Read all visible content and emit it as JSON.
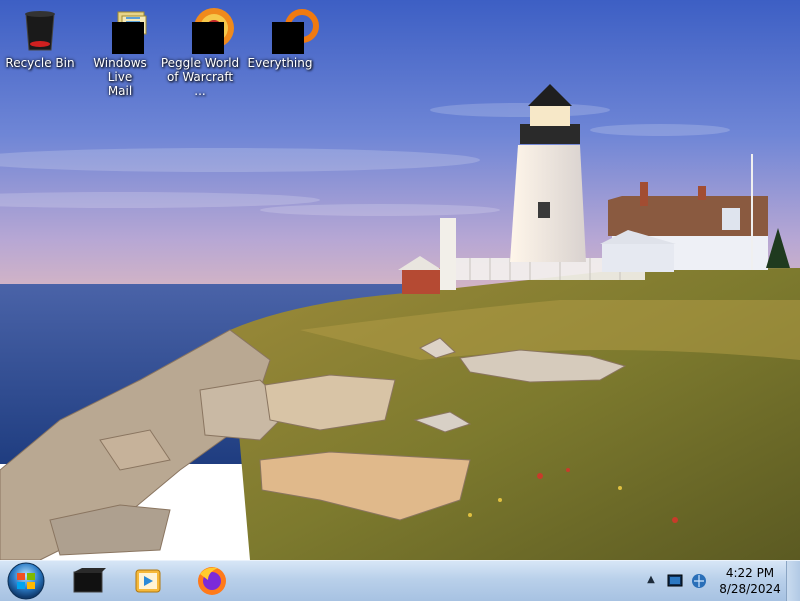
{
  "desktop": {
    "icons": [
      {
        "label": "Recycle Bin"
      },
      {
        "label": "Windows Live\nMail"
      },
      {
        "label": "Peggle World\nof Warcraft ..."
      },
      {
        "label": "Everything"
      }
    ]
  },
  "taskbar": {
    "start": {
      "icon": "windows-orb-icon"
    },
    "apps": [
      {
        "icon": "file-explorer-icon"
      },
      {
        "icon": "media-player-icon"
      },
      {
        "icon": "firefox-icon"
      }
    ],
    "tray": {
      "icons": [
        "show-hidden-icons-arrow",
        "action-center-icon",
        "network-icon"
      ],
      "time": "4:22 PM",
      "date": "8/28/2024"
    }
  }
}
